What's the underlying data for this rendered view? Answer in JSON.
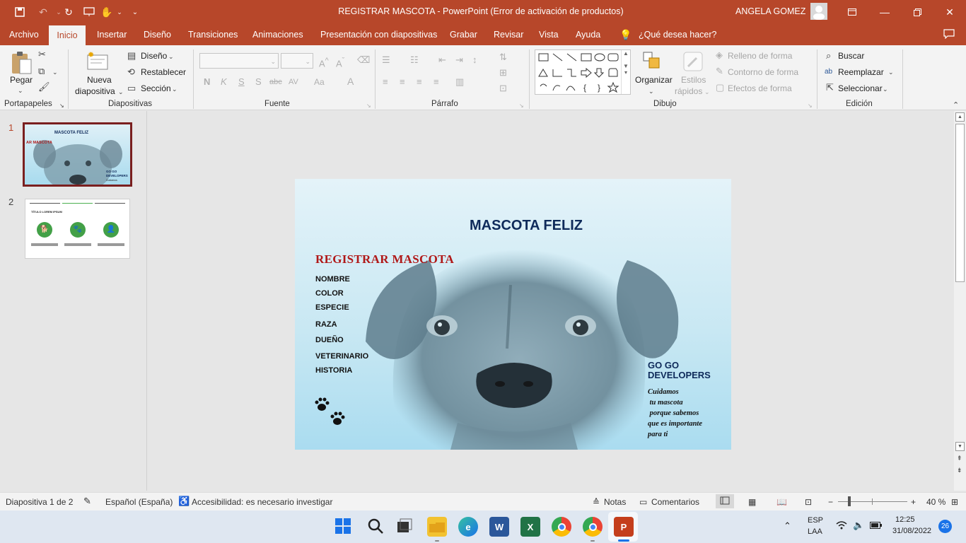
{
  "window": {
    "title": "REGISTRAR MASCOTA  -  PowerPoint (Error de activación de productos)",
    "user": "ANGELA GOMEZ"
  },
  "tabs": [
    "Archivo",
    "Inicio",
    "Insertar",
    "Diseño",
    "Transiciones",
    "Animaciones",
    "Presentación con diapositivas",
    "Grabar",
    "Revisar",
    "Vista",
    "Ayuda"
  ],
  "tell_me": "¿Qué desea hacer?",
  "ribbon": {
    "portapapeles": {
      "pegar": "Pegar",
      "label": "Portapapeles"
    },
    "diapositivas": {
      "nueva": "Nueva",
      "diapositiva": "diapositiva",
      "diseno": "Diseño",
      "restablecer": "Restablecer",
      "seccion": "Sección",
      "label": "Diapositivas"
    },
    "fuente": {
      "bold": "N",
      "italic": "K",
      "underline": "S",
      "shadow": "S",
      "strike": "abc",
      "spacing": "AV",
      "case": "Aa",
      "color": "A",
      "label": "Fuente"
    },
    "parrafo": {
      "label": "Párrafo"
    },
    "dibujo": {
      "organizar": "Organizar",
      "estilos": "Estilos",
      "rapidos": "rápidos",
      "relleno": "Relleno de forma",
      "contorno": "Contorno de forma",
      "efectos": "Efectos de forma",
      "label": "Dibujo"
    },
    "edicion": {
      "buscar": "Buscar",
      "reemplazar": "Reemplazar",
      "seleccionar": "Seleccionar",
      "label": "Edición"
    }
  },
  "thumbnails": [
    {
      "num": "1",
      "title": "MASCOTA FELIZ",
      "sub": "AR MASCOTA",
      "corner": "GO GO DEVELOPERS",
      "tag": "Cuidamos"
    },
    {
      "num": "2",
      "title": "TÍTULO LOREM IPSUM"
    }
  ],
  "slide": {
    "title": "MASCOTA FELIZ",
    "subtitle": "REGISTRAR MASCOTA",
    "fields": [
      "NOMBRE",
      "COLOR",
      "ESPECIE",
      "RAZA",
      "DUEÑO",
      "VETERINARIO",
      "HISTORIA"
    ],
    "brand_line1": "GO GO",
    "brand_line2": "DEVELOPERS",
    "tagline": [
      "Cuidamos",
      " tu mascota",
      " porque sabemos",
      "que es importante",
      "para ti"
    ]
  },
  "status": {
    "slide_info": "Diapositiva 1 de 2",
    "language": "Español (España)",
    "accessibility": "Accesibilidad: es necesario investigar",
    "notes": "Notas",
    "comments": "Comentarios",
    "zoom": "40 %"
  },
  "taskbar": {
    "lang1": "ESP",
    "lang2": "LAA",
    "time": "12:25",
    "date": "31/08/2022",
    "badge": "26"
  },
  "colors": {
    "accent": "#b7472a",
    "slide_title": "#0e2a5a",
    "slide_subtitle": "#b01818"
  }
}
